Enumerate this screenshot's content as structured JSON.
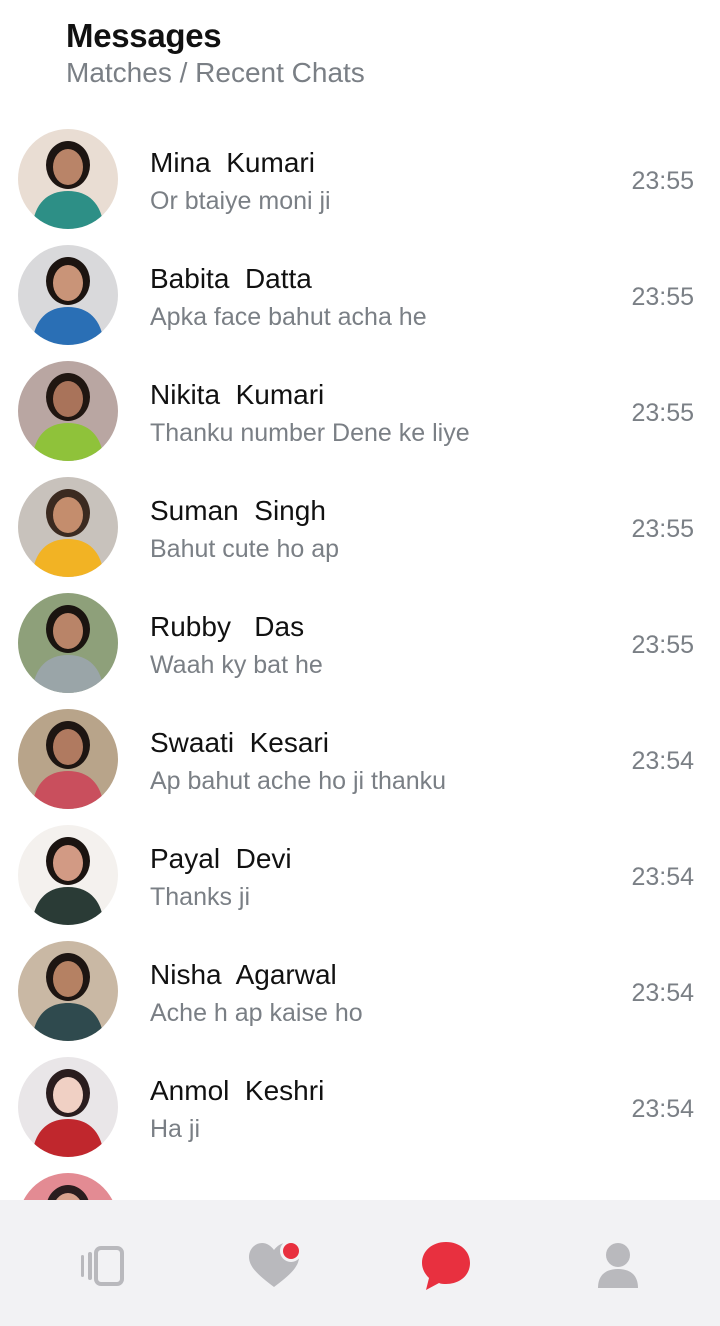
{
  "header": {
    "title": "Messages",
    "subtitle": "Matches / Recent Chats"
  },
  "chats": [
    {
      "name": "Mina  Kumari",
      "message": "Or btaiye moni ji",
      "time": "23:55",
      "avatar": {
        "bg": "#e9ddd3",
        "hair": "#1d1512",
        "skin": "#b98468",
        "outfit": "#2d8f86"
      }
    },
    {
      "name": "Babita  Datta",
      "message": "Apka face bahut acha he",
      "time": "23:55",
      "avatar": {
        "bg": "#d9d9db",
        "hair": "#1c1410",
        "skin": "#c99478",
        "outfit": "#2a6fb5"
      }
    },
    {
      "name": "Nikita  Kumari",
      "message": "Thanku number Dene ke liye",
      "time": "23:55",
      "avatar": {
        "bg": "#b9a6a2",
        "hair": "#201611",
        "skin": "#a9735a",
        "outfit": "#8fc23a"
      }
    },
    {
      "name": "Suman  Singh",
      "message": "Bahut cute ho ap",
      "time": "23:55",
      "avatar": {
        "bg": "#c8c2bc",
        "hair": "#3b2a20",
        "skin": "#c48d6d",
        "outfit": "#f2b324"
      }
    },
    {
      "name": "Rubby   Das",
      "message": "Waah ky bat he",
      "time": "23:55",
      "avatar": {
        "bg": "#8ea07a",
        "hair": "#1a1410",
        "skin": "#b98468",
        "outfit": "#9aa5a8"
      }
    },
    {
      "name": "Swaati  Kesari",
      "message": "Ap bahut ache ho ji thanku",
      "time": "23:54",
      "avatar": {
        "bg": "#b8a48a",
        "hair": "#1d1512",
        "skin": "#b07a60",
        "outfit": "#c94f5d"
      }
    },
    {
      "name": "Payal  Devi",
      "message": "Thanks ji",
      "time": "23:54",
      "avatar": {
        "bg": "#f4f1ee",
        "hair": "#1b1411",
        "skin": "#d29a84",
        "outfit": "#2a3b36"
      }
    },
    {
      "name": "Nisha  Agarwal",
      "message": "Ache h ap kaise ho",
      "time": "23:54",
      "avatar": {
        "bg": "#c9b8a4",
        "hair": "#1d1512",
        "skin": "#b58163",
        "outfit": "#2f4a4e"
      }
    },
    {
      "name": "Anmol  Keshri",
      "message": "Ha ji",
      "time": "23:54",
      "avatar": {
        "bg": "#e9e6e8",
        "hair": "#2a1d1e",
        "skin": "#f0d0c4",
        "outfit": "#c0272d"
      }
    }
  ],
  "partial_row": {
    "avatar": {
      "bg": "#e38b93",
      "hair": "#2a1d1e",
      "skin": "#d9a38e",
      "outfit": "#d9d2c5"
    }
  },
  "tabbar": {
    "items": [
      {
        "icon": "cards-stack-icon",
        "color": "#b9b9bd"
      },
      {
        "icon": "heart-notification-icon",
        "color": "#b9b9bd",
        "badge_color": "#e8303f"
      },
      {
        "icon": "chat-bubble-icon",
        "color": "#e8303f",
        "active": true
      },
      {
        "icon": "profile-icon",
        "color": "#b9b9bd"
      }
    ]
  },
  "colors": {
    "accent": "#e8303f",
    "secondary_text": "#7a7f85",
    "tabbar_bg": "#f2f2f4"
  }
}
